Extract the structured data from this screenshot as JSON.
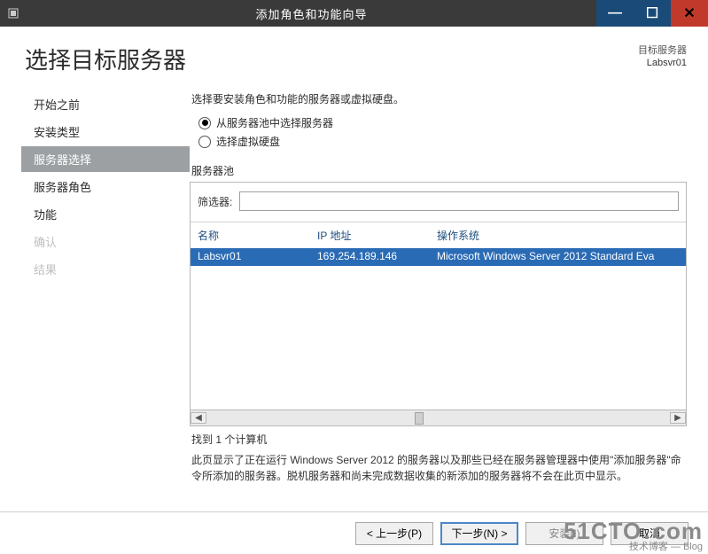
{
  "window": {
    "title": "添加角色和功能向导",
    "min_glyph": "—",
    "max_glyph": "☐",
    "close_glyph": "✕"
  },
  "header": {
    "page_title": "选择目标服务器",
    "target_label": "目标服务器",
    "target_value": "Labsvr01"
  },
  "sidebar": {
    "items": [
      {
        "label": "开始之前",
        "state": "normal"
      },
      {
        "label": "安装类型",
        "state": "normal"
      },
      {
        "label": "服务器选择",
        "state": "active"
      },
      {
        "label": "服务器角色",
        "state": "normal"
      },
      {
        "label": "功能",
        "state": "normal"
      },
      {
        "label": "确认",
        "state": "disabled"
      },
      {
        "label": "结果",
        "state": "disabled"
      }
    ]
  },
  "content": {
    "instruction": "选择要安装角色和功能的服务器或虚拟硬盘。",
    "radio_pool": "从服务器池中选择服务器",
    "radio_vhd": "选择虚拟硬盘",
    "radio_selected": "pool",
    "pool_section_label": "服务器池",
    "filter_label": "筛选器:",
    "filter_value": "",
    "columns": {
      "name": "名称",
      "ip": "IP 地址",
      "os": "操作系统"
    },
    "rows": [
      {
        "name": "Labsvr01",
        "ip": "169.254.189.146",
        "os": "Microsoft Windows Server 2012 Standard Eva"
      }
    ],
    "found_text": "找到 1 个计算机",
    "long_note": "此页显示了正在运行 Windows Server 2012 的服务器以及那些已经在服务器管理器中使用\"添加服务器\"命令所添加的服务器。脱机服务器和尚未完成数据收集的新添加的服务器将不会在此页中显示。"
  },
  "buttons": {
    "prev": "< 上一步(P)",
    "next": "下一步(N) >",
    "install": "安装(I)",
    "cancel": "取消"
  },
  "watermark": {
    "line1_a": "51CTO",
    "line1_b": "com",
    "line2": "技术博客 — Blog"
  }
}
